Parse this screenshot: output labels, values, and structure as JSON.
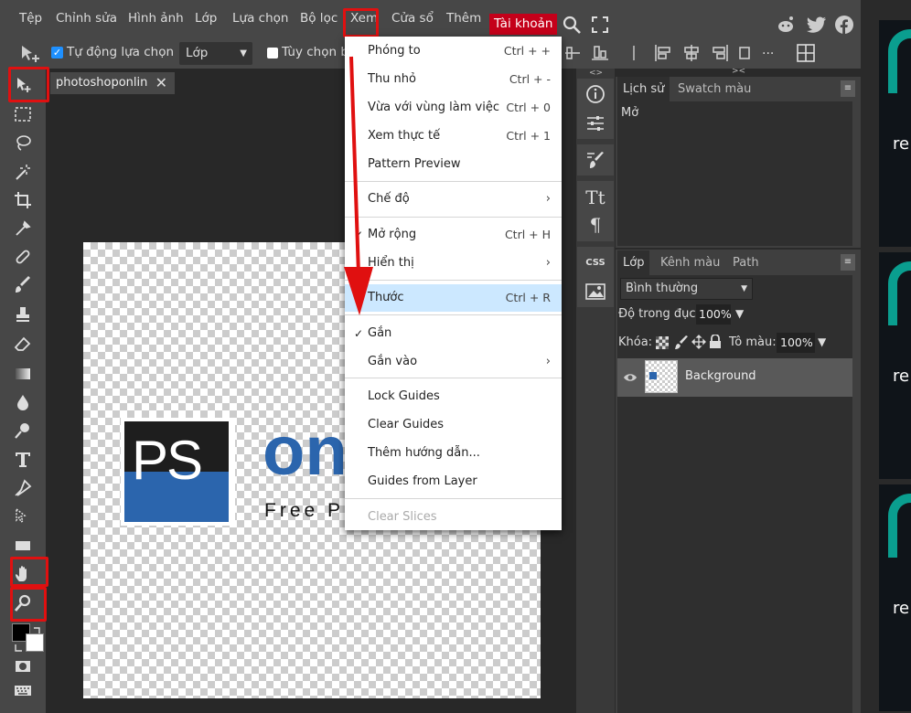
{
  "menubar": {
    "items": [
      "Tệp",
      "Chỉnh sửa",
      "Hình ảnh",
      "Lớp",
      "Lựa chọn",
      "Bộ lọc",
      "Xem",
      "Cửa sổ",
      "Thêm"
    ],
    "account": "Tài khoản"
  },
  "options": {
    "auto_select_label": "Tự động lựa chọn",
    "auto_select_checked": true,
    "layer_select": "Lớp",
    "transform_label": "Tùy chọn bi",
    "more": "..."
  },
  "document": {
    "tab_title": "photoshoponlin",
    "logo_mark": "PS",
    "logo_text": "on",
    "logo_tagline": "Free Pl"
  },
  "view_menu": {
    "items": [
      {
        "label": "Phóng to",
        "shortcut": "Ctrl + +"
      },
      {
        "label": "Thu nhỏ",
        "shortcut": "Ctrl + -"
      },
      {
        "label": "Vừa với vùng làm việc",
        "shortcut": "Ctrl + 0"
      },
      {
        "label": "Xem thực tế",
        "shortcut": "Ctrl + 1"
      },
      {
        "label": "Pattern Preview",
        "shortcut": ""
      },
      {
        "label": "Chế độ",
        "shortcut": "",
        "submenu": true
      },
      {
        "label": "Mở rộng",
        "shortcut": "Ctrl + H",
        "checked": true
      },
      {
        "label": "Hiển thị",
        "shortcut": "",
        "submenu": true
      },
      {
        "label": "Thước",
        "shortcut": "Ctrl + R",
        "highlighted": true
      },
      {
        "label": "Gắn",
        "shortcut": "",
        "checked": true
      },
      {
        "label": "Gắn vào",
        "shortcut": "",
        "submenu": true
      },
      {
        "label": "Lock Guides",
        "shortcut": ""
      },
      {
        "label": "Clear Guides",
        "shortcut": ""
      },
      {
        "label": "Thêm hướng dẫn...",
        "shortcut": ""
      },
      {
        "label": "Guides from Layer",
        "shortcut": ""
      },
      {
        "label": "Clear Slices",
        "shortcut": "",
        "disabled": true
      }
    ]
  },
  "history_panel": {
    "tabs": [
      "Lịch sử",
      "Swatch màu"
    ],
    "entries": [
      "Mở"
    ]
  },
  "layers_panel": {
    "tabs": [
      "Lớp",
      "Kênh màu",
      "Path"
    ],
    "blend_mode": "Bình thường",
    "opacity_label": "Độ trong đục:",
    "opacity_value": "100%",
    "lock_label": "Khóa:",
    "fill_label": "Tô màu:",
    "fill_value": "100%",
    "layers": [
      {
        "name": "Background"
      }
    ]
  },
  "side_ads": {
    "text": "re"
  },
  "colors": {
    "accent_red": "#e01010",
    "account_red": "#c4001a",
    "menu_highlight": "#cce8ff",
    "ps_blue": "#2b65ad",
    "ad_green": "#0a9e8f"
  }
}
